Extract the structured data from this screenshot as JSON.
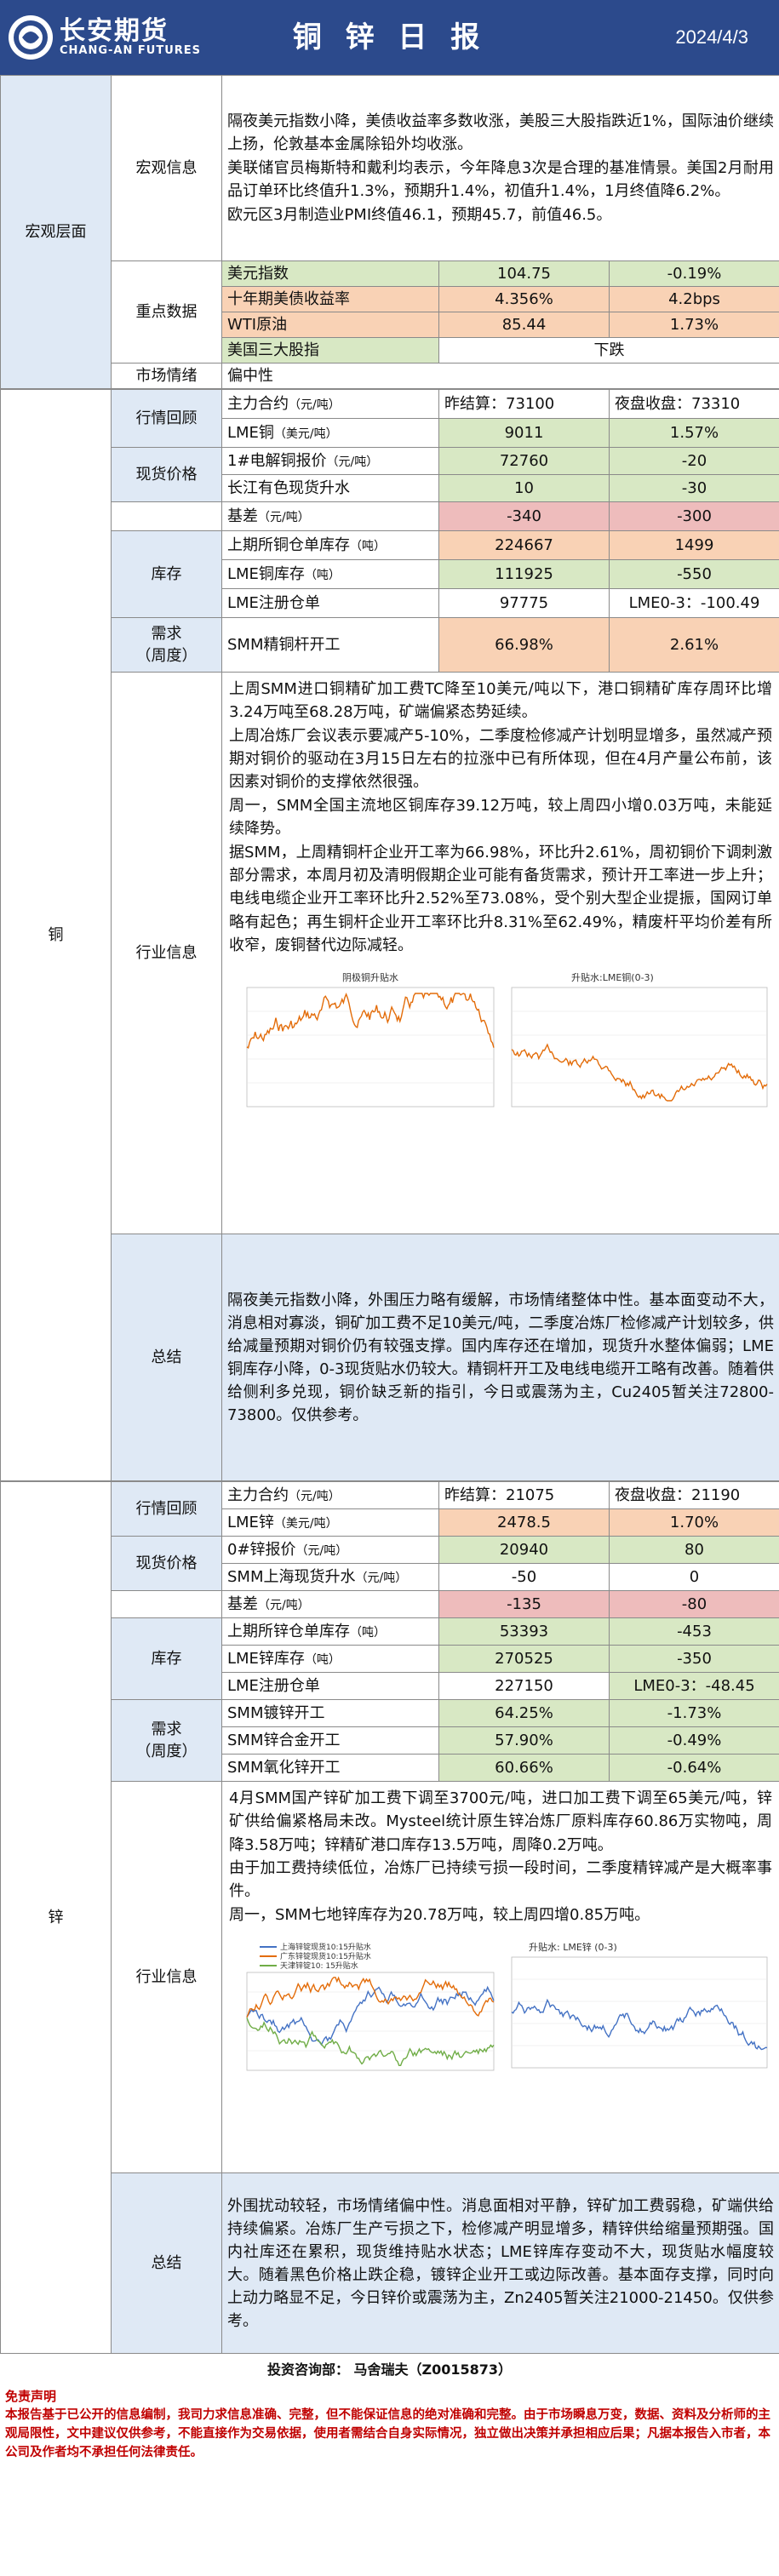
{
  "header": {
    "company_cn": "长安期货",
    "company_en": "CHANG-AN FUTURES",
    "title": "铜 锌 日 报",
    "date": "2024/4/3"
  },
  "macro": {
    "category": "宏观层面",
    "info_label": "宏观信息",
    "info_lines": [
      "隔夜美元指数小降，美债收益率多数收涨，美股三大股指跌近1%，国际油价继续上扬，伦敦基本金属除铅外均收涨。",
      "美联储官员梅斯特和戴利均表示，今年降息3次是合理的基准情景。美国2月耐用品订单环比终值升1.3%，预期升1.4%，初值升1.4%，1月终值降6.2%。",
      "欧元区3月制造业PMI终值46.1，预期45.7，前值46.5。"
    ],
    "key_label": "重点数据",
    "key_rows": [
      {
        "name": "美元指数",
        "value": "104.75",
        "change": "-0.19%"
      },
      {
        "name": "十年期美债收益率",
        "value": "4.356%",
        "change": "4.2bps"
      },
      {
        "name": "WTI原油",
        "value": "85.44",
        "change": "1.73%"
      },
      {
        "name": "美国三大股指",
        "value": "",
        "change": "下跌"
      }
    ],
    "sentiment_label": "市场情绪",
    "sentiment_value": "偏中性"
  },
  "copper": {
    "category": "铜",
    "quote_label": "行情回顾",
    "main_contract": "主力合约",
    "main_unit": "（元/吨）",
    "prev_close": "昨结算：73100",
    "night_close": "夜盘收盘：73310",
    "lme_name": "LME铜",
    "lme_unit": "（美元/吨）",
    "lme_value": "9011",
    "lme_change": "1.57%",
    "spot_label": "现货价格",
    "spot1_name": "1#电解铜报价",
    "spot1_unit": "（元/吨）",
    "spot1_value": "72760",
    "spot1_change": "-20",
    "spot2_name": "长江有色现货升水",
    "spot2_value": "10",
    "spot2_change": "-30",
    "basis_name": "基差",
    "basis_unit": "（元/吨）",
    "basis_value": "-340",
    "basis_change": "-300",
    "stock_label": "库存",
    "stock1_name": "上期所铜仓单库存",
    "stock1_unit": "（吨）",
    "stock1_value": "224667",
    "stock1_change": "1499",
    "stock2_name": "LME铜库存",
    "stock2_unit": "（吨）",
    "stock2_value": "111925",
    "stock2_change": "-550",
    "stock3_name": "LME注册仓单",
    "stock3_value": "97775",
    "stock3_change": "LME0-3：-100.49",
    "demand_label_1": "需求",
    "demand_label_2": "（周度）",
    "demand_name": "SMM精铜杆开工",
    "demand_value": "66.98%",
    "demand_change": "2.61%",
    "industry_label": "行业信息",
    "industry_lines": [
      "上周SMM进口铜精矿加工费TC降至10美元/吨以下，港口铜精矿库存周环比增3.24万吨至68.28万吨，矿端偏紧态势延续。",
      "上周冶炼厂会议表示要减产5-10%，二季度检修减产计划明显增多，虽然减产预期对铜价的驱动在3月15日左右的拉涨中已有所体现，但在4月产量公布前，该因素对铜价的支撑依然很强。",
      "周一，SMM全国主流地区铜库存39.12万吨，较上周四小增0.03万吨，未能延续降势。",
      "据SMM，上周精铜杆企业开工率为66.98%，环比升2.61%，周初铜价下调刺激部分需求，本周月初及清明假期企业可能有备货需求，预计开工率进一步上升；电线电缆企业开工率环比升2.52%至73.08%，受个别大型企业提振，国网订单略有起色；再生铜杆企业开工率环比升8.31%至62.49%，精废杆平均价差有所收窄，废铜替代边际减轻。"
    ],
    "chart1_title": "阴极铜升贴水",
    "chart2_title": "升贴水:LME铜(0-3)",
    "summary_label": "总结",
    "summary": "隔夜美元指数小降，外围压力略有缓解，市场情绪整体中性。基本面变动不大，消息相对寡淡，铜矿加工费不足10美元/吨，二季度冶炼厂检修减产计划较多，供给减量预期对铜价仍有较强支撑。国内库存还在增加，现货升水整体偏弱；LME铜库存小降，0-3现货贴水仍较大。精铜杆开工及电线电缆开工略有改善。随着供给侧利多兑现，铜价缺乏新的指引，今日或震荡为主，Cu2405暂关注72800-73800。仅供参考。"
  },
  "zinc": {
    "category": "锌",
    "quote_label": "行情回顾",
    "main_contract": "主力合约",
    "main_unit": "（元/吨）",
    "prev_close": "昨结算：21075",
    "night_close": "夜盘收盘：21190",
    "lme_name": "LME锌",
    "lme_unit": "（美元/吨）",
    "lme_value": "2478.5",
    "lme_change": "1.70%",
    "spot_label": "现货价格",
    "spot1_name": "0#锌报价",
    "spot1_unit": "（元/吨）",
    "spot1_value": "20940",
    "spot1_change": "80",
    "spot2_name": "SMM上海现货升水",
    "spot2_unit": "（元/吨）",
    "spot2_value": "-50",
    "spot2_change": "0",
    "basis_name": "基差",
    "basis_unit": "（元/吨）",
    "basis_value": "-135",
    "basis_change": "-80",
    "stock_label": "库存",
    "stock1_name": "上期所锌仓单库存",
    "stock1_unit": "（吨）",
    "stock1_value": "53393",
    "stock1_change": "-453",
    "stock2_name": "LME锌库存",
    "stock2_unit": "（吨）",
    "stock2_value": "270525",
    "stock2_change": "-350",
    "stock3_name": "LME注册仓单",
    "stock3_value": "227150",
    "stock3_change": "LME0-3：-48.45",
    "demand_label_1": "需求",
    "demand_label_2": "（周度）",
    "demand_rows": [
      {
        "name": "SMM镀锌开工",
        "value": "64.25%",
        "change": "-1.73%"
      },
      {
        "name": "SMM锌合金开工",
        "value": "57.90%",
        "change": "-0.49%"
      },
      {
        "name": "SMM氧化锌开工",
        "value": "60.66%",
        "change": "-0.64%"
      }
    ],
    "industry_label": "行业信息",
    "industry_lines": [
      "4月SMM国产锌矿加工费下调至3700元/吨，进口加工费下调至65美元/吨，锌矿供给偏紧格局未改。Mysteel统计原生锌冶炼厂原料库存60.86万实物吨，周降3.58万吨；锌精矿港口库存13.5万吨，周降0.2万吨。",
      "由于加工费持续低位，冶炼厂已持续亏损一段时间，二季度精锌减产是大概率事件。",
      "周一，SMM七地锌库存为20.78万吨，较上周四增0.85万吨。"
    ],
    "chart1_legend": [
      "上海锌锭现货10:15升贴水",
      "广东锌锭现货10:15升贴水",
      "天津锌锭10: 15升贴水"
    ],
    "chart2_title": "升贴水: LME锌 (0-3)",
    "summary_label": "总结",
    "summary": "外围扰动较轻，市场情绪偏中性。消息面相对平静，锌矿加工费弱稳，矿端供给持续偏紧。冶炼厂生产亏损之下，检修减产明显增多，精锌供给缩量预期强。国内社库还在累积，现货维持贴水状态；LME锌库存变动不大，现货贴水幅度较大。随着黑色价格止跌企稳，镀锌企业开工或边际改善。基本面存支撑，同时向上动力略显不足，今日锌价或震荡为主，Zn2405暂关注21000-21450。仅供参考。"
  },
  "footer": {
    "contact": "投资咨询部：  马舍瑞夫（Z0015873）",
    "disclaimer_title": "免责声明",
    "disclaimer": "本报告基于已公开的信息编制，我司力求信息准确、完整，但不能保证信息的绝对准确和完整。由于市场瞬息万变，数据、资料及分析师的主观局限性，文中建议仅供参考，不能直接作为交易依据，使用者需结合自身实际情况，独立做出决策并承担相应后果；凡据本报告入市者，本公司及作者均不承担任何法律责任。"
  },
  "colors": {
    "header_blue": "#2c4a8c",
    "label_blue": "#dfe9f5",
    "value_green": "#d8e8c4",
    "value_orange": "#f9d2b5",
    "value_pink": "#eebcbc",
    "line_orange": "#e36c09",
    "line_blue": "#4472c4",
    "line_green": "#70ad47",
    "disclaimer_red": "#c00000"
  }
}
